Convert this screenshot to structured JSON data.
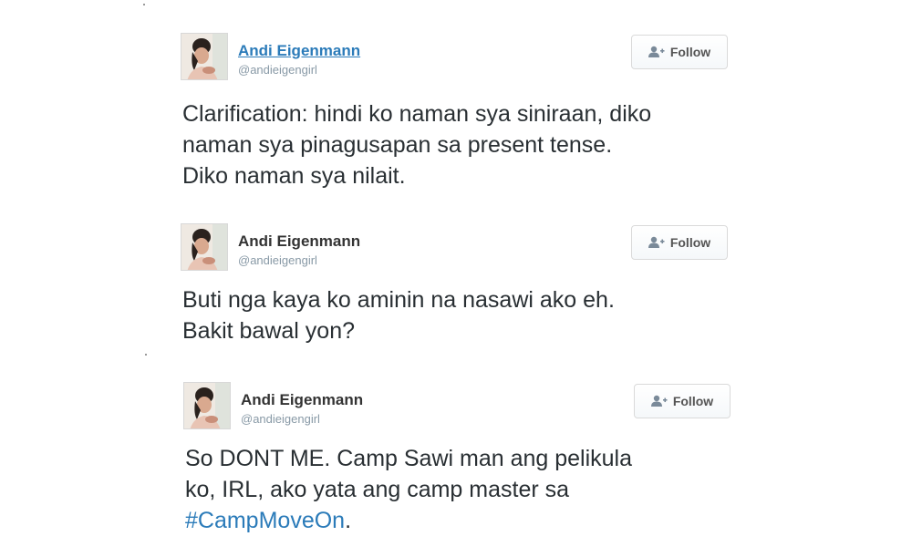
{
  "tweets": [
    {
      "name": "Andi Eigenmann",
      "handle": "@andieigengirl",
      "follow_label": "Follow",
      "lines": [
        "Clarification: hindi ko naman sya siniraan, diko",
        "naman sya pinagusapan sa present tense.",
        "Diko naman sya nilait."
      ]
    },
    {
      "name": "Andi Eigenmann",
      "handle": "@andieigengirl",
      "follow_label": "Follow",
      "lines": [
        "Buti nga kaya ko aminin na nasawi ako eh.",
        "Bakit bawal yon?"
      ]
    },
    {
      "name": "Andi Eigenmann",
      "handle": "@andieigengirl",
      "follow_label": "Follow",
      "lines": [
        "So DONT ME. Camp Sawi man ang pelikula",
        "ko, IRL, ako yata ang camp master sa"
      ],
      "hashtag": "#CampMoveOn",
      "hashtag_suffix": "."
    }
  ],
  "colors": {
    "link": "#2b7bb9",
    "text": "#292f33",
    "handle": "#8899a6"
  },
  "icons": {
    "follow": "add-user-icon",
    "avatar": "profile-photo"
  }
}
